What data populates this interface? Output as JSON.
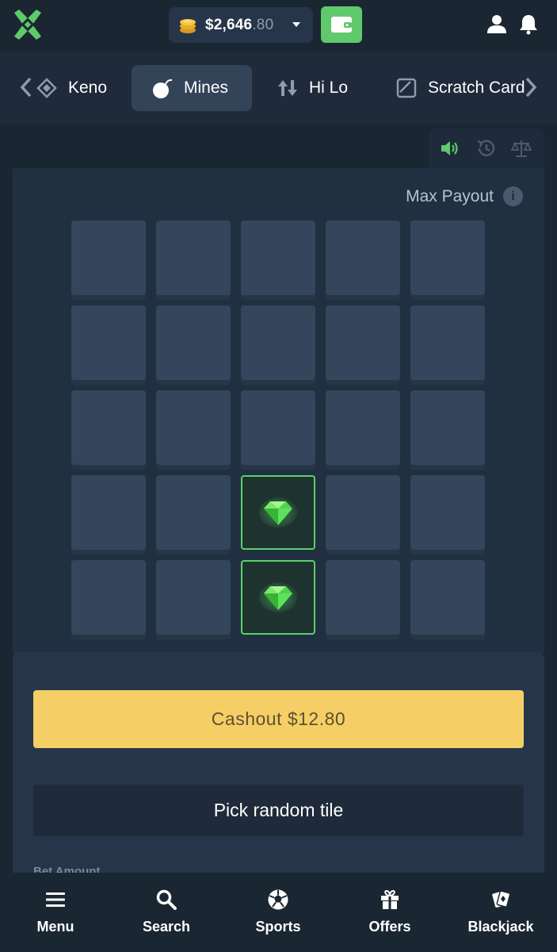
{
  "header": {
    "balance_whole": "$2,646",
    "balance_cents": ".80",
    "brand_color": "#5fc96b",
    "icons": [
      "logo-icon",
      "coin-stack-icon",
      "chevron-down-icon",
      "wallet-icon",
      "user-icon",
      "bell-icon"
    ]
  },
  "game_tabs": [
    {
      "label": "Keno",
      "icon": "keno-icon",
      "active": false
    },
    {
      "label": "Mines",
      "icon": "bomb-icon",
      "active": true
    },
    {
      "label": "Hi Lo",
      "icon": "up-down-arrows-icon",
      "active": false
    },
    {
      "label": "Scratch Card",
      "icon": "scratch-card-icon",
      "active": false
    }
  ],
  "toolbar": {
    "icons": [
      "sound-icon",
      "history-icon",
      "fairness-scale-icon"
    ]
  },
  "game": {
    "max_payout_label": "Max Payout",
    "info_glyph": "i",
    "grid_rows": 5,
    "grid_cols": 5,
    "revealed_gems": [
      {
        "row": 4,
        "col": 3
      },
      {
        "row": 5,
        "col": 3
      }
    ],
    "gem_color": "#5bd06a"
  },
  "controls": {
    "cashout_label": "Cashout $12.80",
    "random_label": "Pick random tile",
    "bet_amount_label": "Bet Amount",
    "cashout_color": "#f5cf66"
  },
  "bottom_nav": [
    {
      "label": "Menu",
      "icon": "menu-icon"
    },
    {
      "label": "Search",
      "icon": "search-icon"
    },
    {
      "label": "Sports",
      "icon": "soccer-ball-icon"
    },
    {
      "label": "Offers",
      "icon": "gift-icon"
    },
    {
      "label": "Blackjack",
      "icon": "playing-cards-icon"
    }
  ]
}
